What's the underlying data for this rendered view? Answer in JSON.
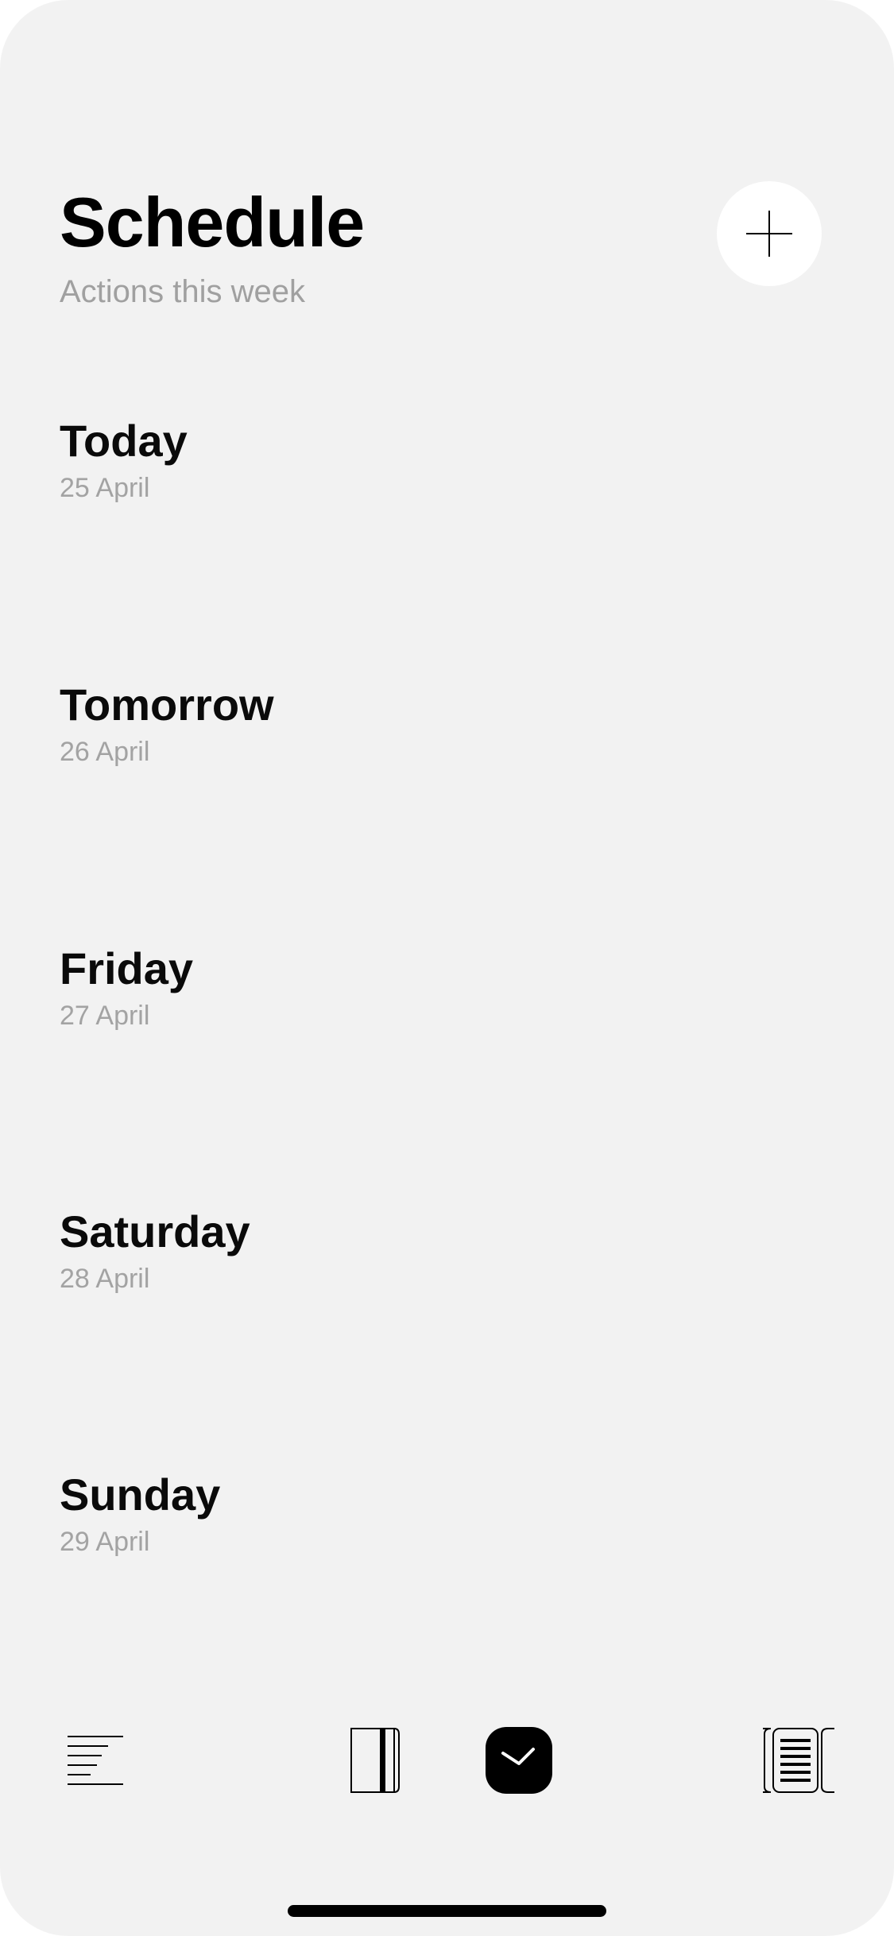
{
  "header": {
    "title": "Schedule",
    "subtitle": "Actions this week",
    "add_icon": "plus-icon"
  },
  "days": [
    {
      "name": "Today",
      "date": "25 April"
    },
    {
      "name": "Tomorrow",
      "date": "26 April"
    },
    {
      "name": "Friday",
      "date": "27 April"
    },
    {
      "name": "Saturday",
      "date": "28 April"
    },
    {
      "name": "Sunday",
      "date": "29 April"
    }
  ],
  "tabbar": {
    "tabs": [
      {
        "icon": "text-lines-icon",
        "active": false
      },
      {
        "icon": "notebook-icon",
        "active": false
      },
      {
        "icon": "clock-icon",
        "active": true
      },
      {
        "icon": "document-stack-icon",
        "active": false
      }
    ]
  },
  "colors": {
    "background": "#f2f2f2",
    "text_primary": "#000000",
    "text_secondary": "#a0a0a0",
    "button_background": "#ffffff",
    "active_tab": "#000000"
  }
}
